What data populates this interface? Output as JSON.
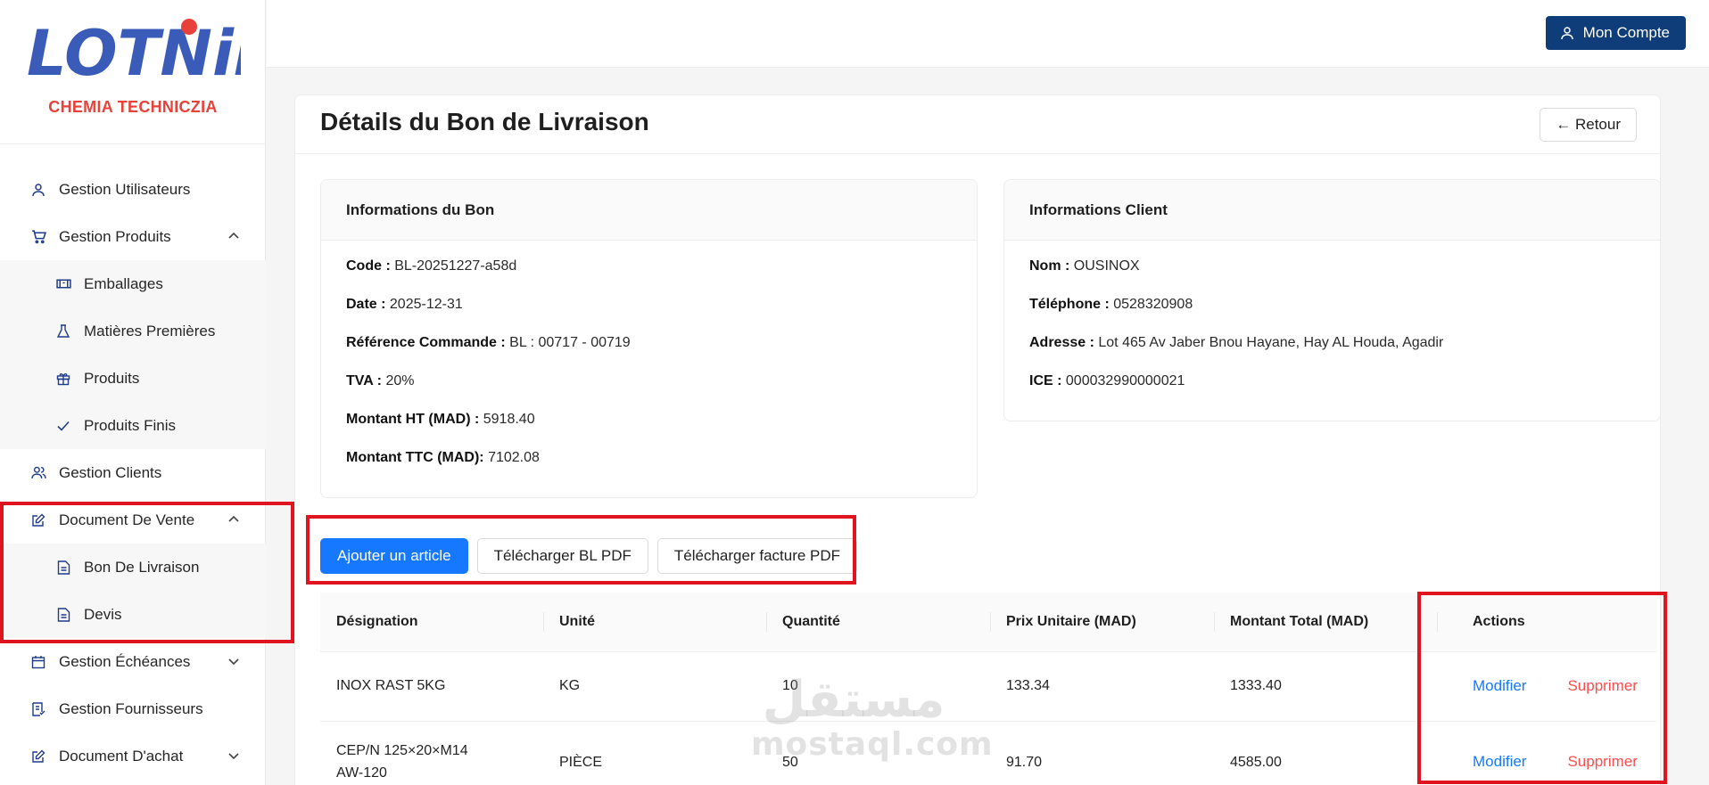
{
  "brand": {
    "logo_text": "LOTNiK",
    "subtitle": "CHEMIA TECHNICZIA",
    "colors": {
      "logo_blue": "#3a5cb8",
      "logo_dot": "#e8413a",
      "subtitle": "#e8413a"
    }
  },
  "sidebar": {
    "items": [
      {
        "label": "Gestion Utilisateurs",
        "icon": "user-icon"
      },
      {
        "label": "Gestion Produits",
        "icon": "cart-icon",
        "expanded": true,
        "children": [
          {
            "label": "Emballages",
            "icon": "package-icon"
          },
          {
            "label": "Matières Premières",
            "icon": "flask-icon"
          },
          {
            "label": "Produits",
            "icon": "gift-icon"
          },
          {
            "label": "Produits Finis",
            "icon": "check-icon"
          }
        ]
      },
      {
        "label": "Gestion Clients",
        "icon": "users-icon"
      },
      {
        "label": "Document De Vente",
        "icon": "edit-icon",
        "expanded": true,
        "children": [
          {
            "label": "Bon De Livraison",
            "icon": "file-icon"
          },
          {
            "label": "Devis",
            "icon": "file-icon"
          }
        ]
      },
      {
        "label": "Gestion Échéances",
        "icon": "calendar-icon",
        "expanded": false
      },
      {
        "label": "Gestion Fournisseurs",
        "icon": "receipt-icon"
      },
      {
        "label": "Document D'achat",
        "icon": "edit-icon",
        "expanded": false
      }
    ]
  },
  "header": {
    "account_label": "Mon Compte"
  },
  "page": {
    "title": "Détails du Bon de Livraison",
    "back_label": "← Retour"
  },
  "bon_info": {
    "heading": "Informations du Bon",
    "fields": [
      {
        "label": "Code :",
        "value": "BL-20251227-a58d"
      },
      {
        "label": "Date :",
        "value": "2025-12-31"
      },
      {
        "label": "Référence Commande :",
        "value": "BL : 00717 - 00719"
      },
      {
        "label": "TVA :",
        "value": "20%"
      },
      {
        "label": "Montant HT (MAD) :",
        "value": "5918.40"
      },
      {
        "label": "Montant TTC (MAD):",
        "value": "7102.08"
      }
    ]
  },
  "client_info": {
    "heading": "Informations Client",
    "fields": [
      {
        "label": "Nom :",
        "value": "OUSINOX"
      },
      {
        "label": "Téléphone :",
        "value": "0528320908"
      },
      {
        "label": "Adresse :",
        "value": "Lot 465 Av Jaber Bnou Hayane, Hay AL Houda, Agadir"
      },
      {
        "label": "ICE :",
        "value": "000032990000021"
      }
    ]
  },
  "actions_bar": {
    "add_label": "Ajouter un article",
    "bl_pdf_label": "Télécharger BL PDF",
    "invoice_pdf_label": "Télécharger facture PDF"
  },
  "table": {
    "columns": [
      "Désignation",
      "Unité",
      "Quantité",
      "Prix Unitaire (MAD)",
      "Montant Total (MAD)",
      "Actions"
    ],
    "rows": [
      {
        "designation": "INOX RAST 5KG",
        "designation_line2": "",
        "unite": "KG",
        "quantite": "10",
        "prix": "133.34",
        "total": "1333.40",
        "edit": "Modifier",
        "delete": "Supprimer"
      },
      {
        "designation": "CEP/N 125×20×M14",
        "designation_line2": "AW-120",
        "unite": "PIÈCE",
        "quantite": "50",
        "prix": "91.70",
        "total": "4585.00",
        "edit": "Modifier",
        "delete": "Supprimer"
      }
    ]
  },
  "watermark": {
    "arabic": "مستقل",
    "latin": "mostaql.com"
  },
  "colors": {
    "primary": "#1677ff",
    "account_bg": "#0f3d7a",
    "danger": "#ff4d4f",
    "highlight": "#e0141e",
    "icon": "#1f3c88"
  }
}
